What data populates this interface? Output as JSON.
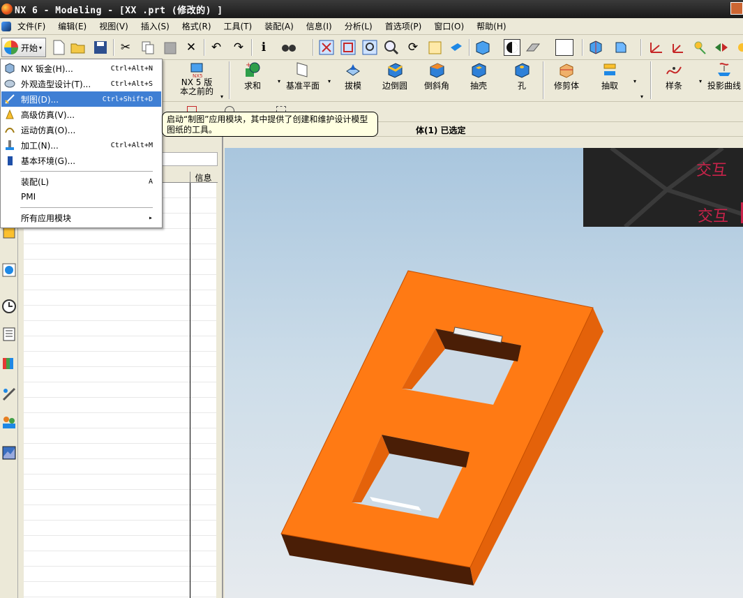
{
  "window": {
    "title": "NX 6 - Modeling - [XX .prt  (修改的) ]"
  },
  "menubar": {
    "items": [
      "文件(F)",
      "编辑(E)",
      "视图(V)",
      "插入(S)",
      "格式(R)",
      "工具(T)",
      "装配(A)",
      "信息(I)",
      "分析(L)",
      "首选项(P)",
      "窗口(O)",
      "帮助(H)"
    ]
  },
  "toolbar": {
    "start_label": "开始",
    "icons": [
      "new-file-icon",
      "open-folder-icon",
      "save-icon",
      "cut-icon",
      "copy-icon",
      "paste-icon",
      "delete-icon",
      "undo-icon",
      "redo-icon",
      "info-icon",
      "binoculars-icon",
      "fit-icon",
      "zoom-window-icon",
      "zoom-icon",
      "zoom-in-icon",
      "rotate-icon",
      "pan-icon",
      "perspective-icon",
      "shaded-icon",
      "render-style-icon",
      "background-icon",
      "view-orient-icon",
      "csys-icon",
      "wcs-icon",
      "datum-icon"
    ]
  },
  "feature_toolbar": {
    "items": [
      {
        "label": "NX 5 版\n本之前的",
        "icon": "nx5-legacy-icon"
      },
      {
        "label": "求和",
        "icon": "unite-icon"
      },
      {
        "label": "基准平面",
        "icon": "datum-plane-icon"
      },
      {
        "label": "拔模",
        "icon": "draft-icon"
      },
      {
        "label": "边倒圆",
        "icon": "edge-blend-icon"
      },
      {
        "label": "倒斜角",
        "icon": "chamfer-icon"
      },
      {
        "label": "抽壳",
        "icon": "shell-icon"
      },
      {
        "label": "孔",
        "icon": "hole-icon"
      },
      {
        "label": "修剪体",
        "icon": "trim-body-icon"
      },
      {
        "label": "抽取",
        "icon": "extract-icon"
      },
      {
        "label": "样条",
        "icon": "spline-icon"
      },
      {
        "label": "投影曲线",
        "icon": "project-curve-icon"
      }
    ]
  },
  "selection_bar": {
    "status": "体(1) 已选定"
  },
  "navigator": {
    "column_info": "信息"
  },
  "start_menu": {
    "items": [
      {
        "label": "NX 钣金(H)...",
        "shortcut": "Ctrl+Alt+N",
        "icon": "sheet-metal-icon"
      },
      {
        "label": "外观造型设计(T)...",
        "shortcut": "Ctrl+Alt+S",
        "icon": "shape-studio-icon"
      },
      {
        "label": "制图(D)...",
        "shortcut": "Ctrl+Shift+D",
        "icon": "drafting-icon",
        "highlighted": true
      },
      {
        "label": "高级仿真(V)...",
        "shortcut": "",
        "icon": "advanced-simulation-icon"
      },
      {
        "label": "运动仿真(O)...",
        "shortcut": "",
        "icon": "motion-simulation-icon"
      },
      {
        "label": "加工(N)...",
        "shortcut": "Ctrl+Alt+M",
        "icon": "manufacturing-icon"
      },
      {
        "label": "基本环境(G)...",
        "shortcut": "",
        "icon": "gateway-icon"
      },
      {
        "label": "装配(L)",
        "shortcut": "A",
        "icon": ""
      },
      {
        "label": "PMI",
        "shortcut": "",
        "icon": ""
      },
      {
        "label": "所有应用模块",
        "shortcut": "▸",
        "icon": ""
      }
    ]
  },
  "tooltip": {
    "text": "启动“制图”应用模块，其中提供了创建和维护设计模型图纸的工具。"
  },
  "watermark": {
    "line1": "交互",
    "line2": "交互"
  },
  "colors": {
    "part_orange": "#ff7a14",
    "highlight": "#3f7fd4",
    "tooltip_bg": "#ffffe1",
    "titlebar": "#222222"
  }
}
